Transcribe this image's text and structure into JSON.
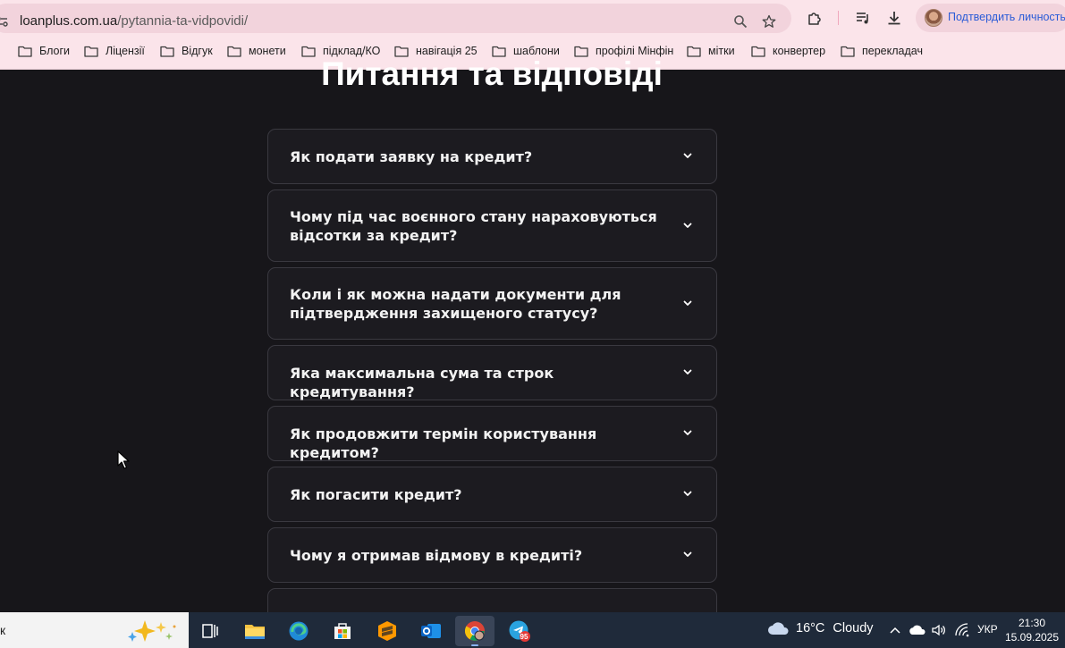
{
  "browser": {
    "url_host": "loanplus.com.ua",
    "url_path": "/pytannia-ta-vidpovidi/",
    "profile_label": "Подтвердить личность",
    "bookmarks": [
      "Блоги",
      "Ліцензії",
      "Відгук",
      "монети",
      "підклад/КО",
      "навігація 25",
      "шаблони",
      "профілі Мінфін",
      "мітки",
      "конвертер",
      "перекладач"
    ]
  },
  "page": {
    "title": "Питання та відповіді",
    "faq": [
      {
        "question": "Як подати заявку на кредит?"
      },
      {
        "question": "Чому під час воєнного стану нараховуються відсотки за кредит?"
      },
      {
        "question": "Коли і як можна надати документи для підтвердження захищеного статусу?"
      },
      {
        "question": "Яка максимальна сума та строк кредитування?"
      },
      {
        "question": "Як продовжити термін користування кредитом?"
      },
      {
        "question": "Як погасити кредит?"
      },
      {
        "question": "Чому я отримав відмову в кредиті?"
      },
      {
        "question": ""
      }
    ]
  },
  "taskbar": {
    "search_text": "к",
    "apps": [
      "task-view",
      "file-explorer",
      "edge",
      "microsoft-store",
      "sublime-text",
      "outlook",
      "chrome",
      "telegram"
    ],
    "telegram_badge": "95",
    "weather_temp": "16°C",
    "weather_condition": "Cloudy",
    "language": "УКР",
    "time": "21:30",
    "date": "15.09.2025"
  }
}
